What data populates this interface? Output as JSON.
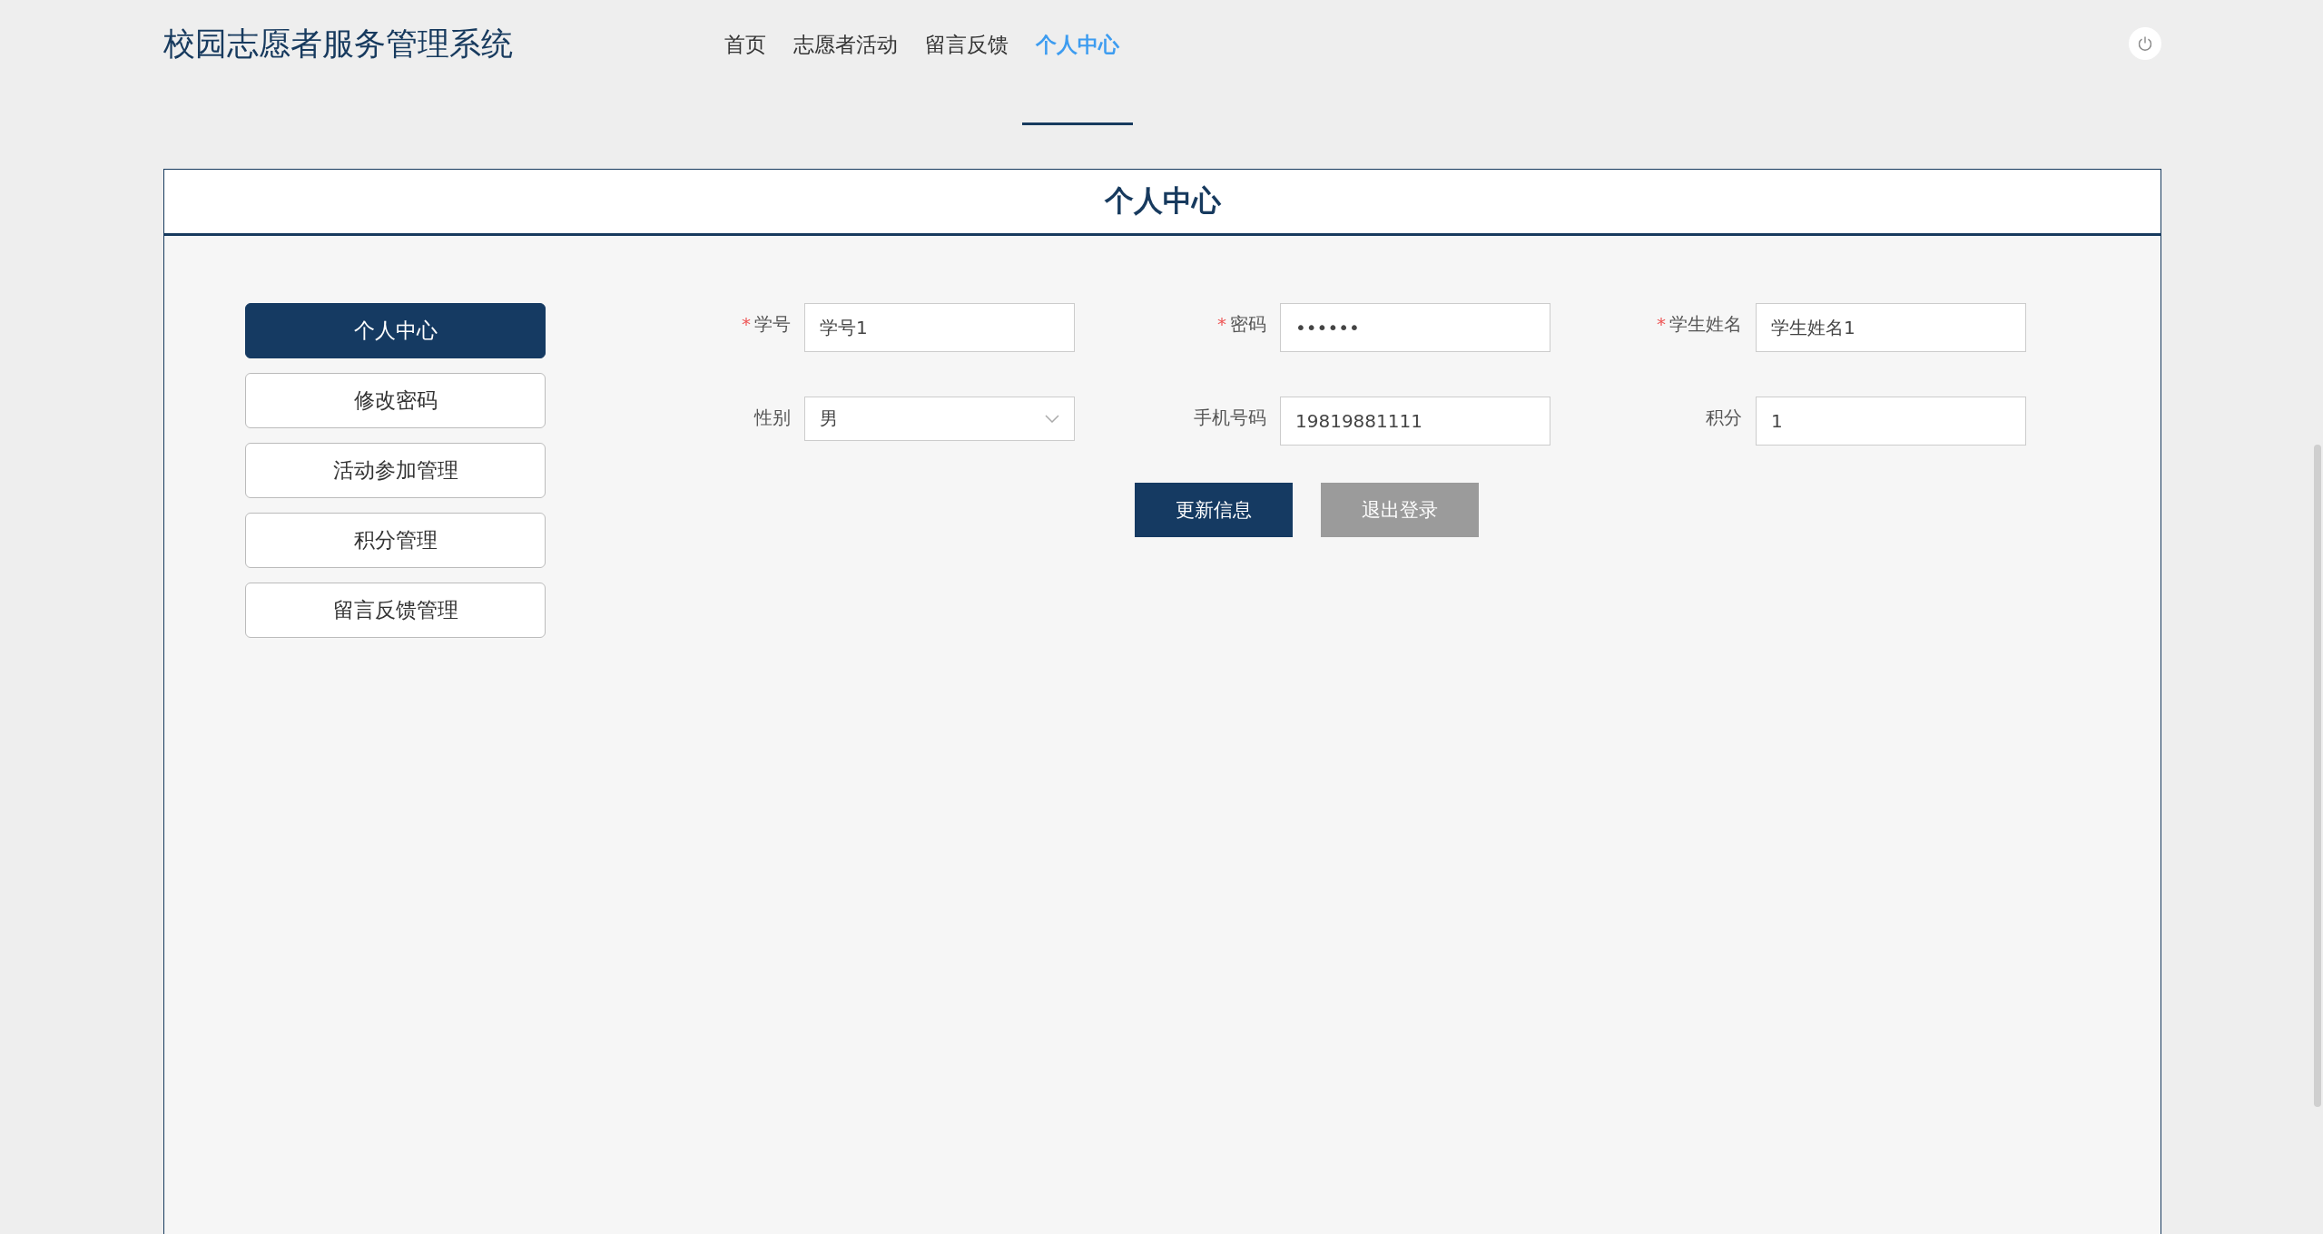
{
  "header": {
    "title": "校园志愿者服务管理系统"
  },
  "nav": [
    {
      "label": "首页",
      "selected": false
    },
    {
      "label": "志愿者活动",
      "selected": false
    },
    {
      "label": "留言反馈",
      "selected": false
    },
    {
      "label": "个人中心",
      "selected": true
    }
  ],
  "panel": {
    "title": "个人中心"
  },
  "sidebar": {
    "items": [
      {
        "label": "个人中心",
        "selected": true
      },
      {
        "label": "修改密码",
        "selected": false
      },
      {
        "label": "活动参加管理",
        "selected": false
      },
      {
        "label": "积分管理",
        "selected": false
      },
      {
        "label": "留言反馈管理",
        "selected": false
      }
    ]
  },
  "form": {
    "fields": [
      {
        "label": "学号",
        "required_mark": "*",
        "kind": "text",
        "value": "学号1"
      },
      {
        "label": "密码",
        "required_mark": "*",
        "kind": "password",
        "value": "••••••"
      },
      {
        "label": "学生姓名",
        "required_mark": "*",
        "kind": "text",
        "value": "学生姓名1"
      },
      {
        "label": "性别",
        "kind": "select",
        "value": "男"
      },
      {
        "label": "手机号码",
        "kind": "text",
        "value": "19819881111"
      },
      {
        "label": "积分",
        "kind": "text",
        "value": "1"
      }
    ],
    "buttons": [
      {
        "label": "更新信息",
        "kind": "primary"
      },
      {
        "label": "退出登录",
        "kind": "secondary"
      }
    ]
  }
}
